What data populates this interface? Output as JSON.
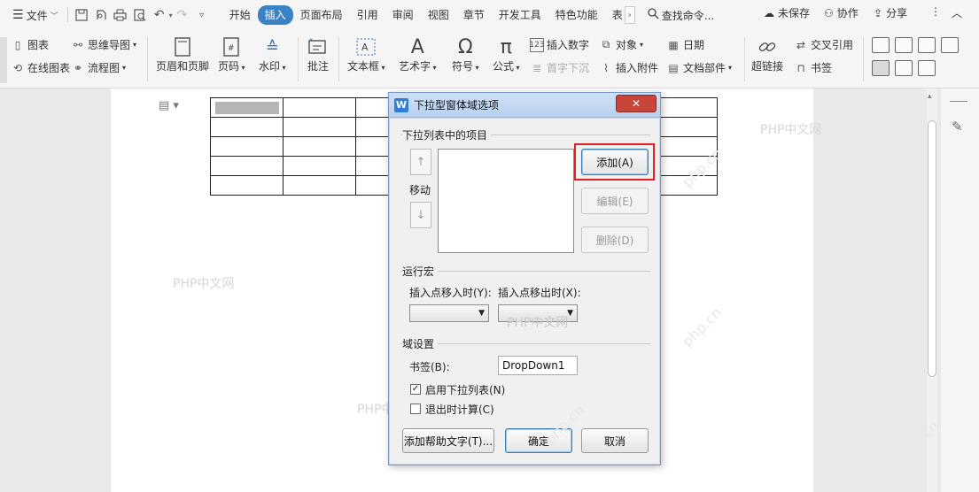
{
  "menubar": {
    "file_label": "文件",
    "tabs": [
      "开始",
      "插入",
      "页面布局",
      "引用",
      "审阅",
      "视图",
      "章节",
      "开发工具",
      "特色功能",
      "表"
    ],
    "active_tab_index": 1,
    "search_label": "查找命令...",
    "unsaved_label": "未保存",
    "collab_label": "协作",
    "share_label": "分享"
  },
  "ribbon": {
    "chart_label": "图表",
    "mindmap_label": "思维导图",
    "online_chart_label": "在线图表",
    "flowchart_label": "流程图",
    "header_footer_label": "页眉和页脚",
    "page_number_label": "页码",
    "watermark_label": "水印",
    "comment_label": "批注",
    "textbox_label": "文本框",
    "wordart_label": "艺术字",
    "symbol_label": "符号",
    "formula_label": "公式",
    "insert_number_label": "插入数字",
    "dropcap_label": "首字下沉",
    "object_label": "对象",
    "attachment_label": "插入附件",
    "date_label": "日期",
    "doc_parts_label": "文档部件",
    "hyperlink_label": "超链接",
    "crossref_label": "交叉引用",
    "bookmark_label": "书签"
  },
  "watermarks": [
    "PHP中文网",
    "PHP中文网",
    "PHP中文网",
    "PHP中文网",
    "php.cn",
    "php.cn",
    "php.cn",
    "php.cn",
    "php.cn",
    "php.cn",
    "php.cn",
    "php.cn"
  ],
  "dialog": {
    "title": "下拉型窗体域选项",
    "close_label": "✕",
    "items_group_label": "下拉列表中的项目",
    "move_label": "移动",
    "add_label": "添加(A)",
    "edit_label": "编辑(E)",
    "delete_label": "删除(D)",
    "macro_group_label": "运行宏",
    "entry_label": "插入点移入时(Y):",
    "exit_label": "插入点移出时(X):",
    "field_group_label": "域设置",
    "bookmark_label": "书签(B):",
    "bookmark_value": "DropDown1",
    "enable_dropdown_label": "启用下拉列表(N)",
    "enable_dropdown_checked": true,
    "calc_on_exit_label": "退出时计算(C)",
    "calc_on_exit_checked": false,
    "help_text_label": "添加帮助文字(T)...",
    "ok_label": "确定",
    "cancel_label": "取消"
  }
}
